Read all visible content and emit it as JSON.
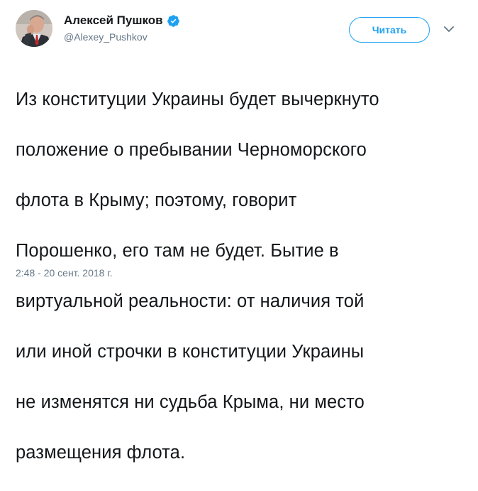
{
  "author": {
    "display_name": "Алексей Пушков",
    "handle": "@Alexey_Pushkov",
    "verified": true,
    "avatar_icon": "profile-photo"
  },
  "actions": {
    "follow_label": "Читать",
    "more_icon": "chevron-down-icon"
  },
  "tweet": {
    "lines": [
      "Из конституции Украины будет вычеркнуто",
      "положение о пребывании Черноморского",
      "флота в Крыму; поэтому, говорит",
      "Порошенко, его там не будет. Бытие в",
      "виртуальной реальности: от наличия той",
      "или иной строчки в конституции Украины",
      "не изменятся ни судьба Крыма, ни место",
      "размещения флота."
    ],
    "timestamp": "2:48 - 20 сент. 2018 г."
  },
  "colors": {
    "accent": "#1da1f2",
    "text": "#14171a",
    "secondary": "#657786"
  }
}
